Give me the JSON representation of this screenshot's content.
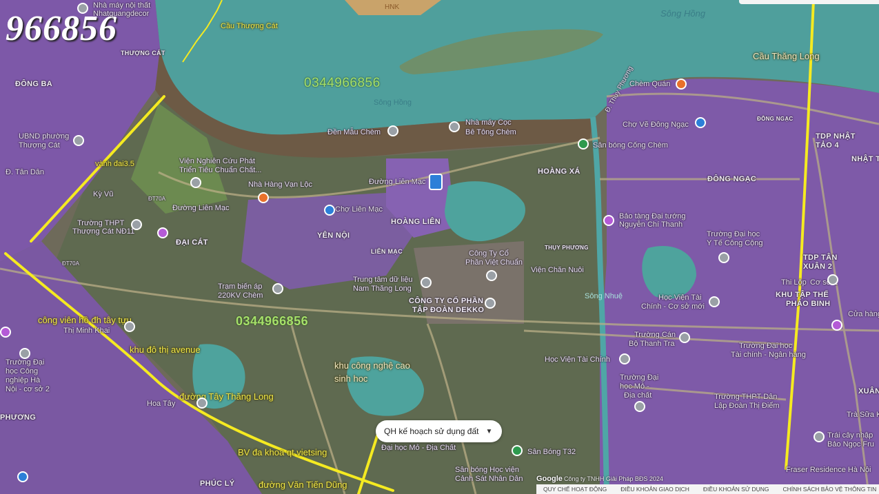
{
  "watermark": "966856",
  "phones": {
    "top": "0344966856",
    "middle": "0344966856"
  },
  "annotations": {
    "cau_thuong_cat": "Cầu Thượng Cát",
    "cau_thang_long": "Cầu Thăng Long",
    "vanh_dai": "vành đai3.5",
    "cong_vien": "công viên hồ đh tây tựu",
    "khu_do_thi": "khu đô thị avenue",
    "khu_cong_nghe": "khu công nghệ cao sinh hoc",
    "duong_tay_thang_long": "đường Tây Thăng Long",
    "bv": "BV đa khoa qt vietsing",
    "duong_van_tien_dung": "đường Văn Tiến Dũng"
  },
  "labels": {
    "nha_may_noi_that": "Nhà máy nội thất",
    "nhat_quang_decor": "Nhatquangdecor",
    "thuong_cat": "THƯỢNG CÁT",
    "dong_ba": "ĐÔNG BA",
    "ubnd": "UBND phường",
    "ubnd_2": "Thượng Cát",
    "tan_dan": "Đ. Tân Dân",
    "ky_vu": "Kỳ Vũ",
    "vien_nghien_cuu": "Viện Nghiên Cứu Phát",
    "vien_nghien_cuu_2": "Triển Tiêu Chuẩn Chất...",
    "nha_hang": "Nhà Hàng Vạn Lộc",
    "duong_lien_mac_1": "Đường Liên Mạc",
    "duong_lien_mac_2": "Đường Liên Mạc",
    "cho_lien_mac": "Chợ Liên Mạc",
    "truong_thpt": "Trường THPT",
    "truong_thpt_2": "Thượng Cát NĐ11",
    "dai_cat": "ĐẠI CÁT",
    "yen_noi": "YÊN NỘI",
    "lien_mac": "LIÊN MẠC",
    "hoang_lien": "HOÀNG LIÊN",
    "den_mau_chem": "Đền Mẫu Chèm",
    "nha_may_coc": "Nhà máy Cọc",
    "be_tong_chem": "Bê Tông Chèm",
    "song_hong_1": "Sông Hồng",
    "song_hong_2": "Sông Hồng",
    "hnk": "HNK",
    "chem_quan": "Chèm Quán",
    "thuy_phuong_road": "Đ. Thụy Phương",
    "cho_ve": "Chợ Vẽ Đông Ngạc",
    "san_bong_cong_chem": "Sân bóng Cống Chèm",
    "hoang_xa": "HOÀNG XÁ",
    "dong_ngac": "ĐÔNG NGẠC",
    "dong_ngac_2": "ĐÔNG NGẠC",
    "tdp_nhat": "TDP NHẬT",
    "tao_4": "TẢO 4",
    "nhat_ta": "NHẬT TẢ",
    "bao_tang": "Bảo tàng Đại tướng",
    "bao_tang_2": "Nguyễn Chí Thanh",
    "truong_dh_y": "Trường Đại học",
    "truong_dh_y_2": "Y Tế Công Cộng",
    "cong_ty_co": "Công Ty Cổ",
    "cong_ty_co_2": "Phần Việt Chuẩn",
    "thuy_phuong": "THỤY PHƯƠNG",
    "vien_chan_nuoi": "Viện Chăn Nuôi",
    "tram_bien_ap": "Trạm biến áp",
    "tram_bien_ap_2": "220KV Chèm",
    "trung_tam": "Trung tâm dữ liệu",
    "trung_tam_2": "Nam Thăng Long",
    "dekko": "CÔNG TY CỔ PHẦN",
    "dekko_2": "TẬP ĐOÀN DEKKO",
    "song_nhue": "Sông Nhuệ",
    "hoc_vien_tai_chinh_cs": "Học Viện Tài",
    "hoc_vien_tai_chinh_cs_2": "Chính - Cơ sở mới",
    "truong_can_bo": "Trường Cán",
    "truong_can_bo_2": "Bộ Thanh Tra",
    "hoc_vien_tai_chinh": "Học Viện Tài Chính",
    "truong_dh_mo": "Trường Đại",
    "truong_dh_mo_2": "học Mỏ -",
    "truong_dh_mo_3": "Địa chất",
    "tdp_tan": "TDP TÂN",
    "xuan_2": "XUÂN 2",
    "thi_lop": "Thi Lộp",
    "co_so_2": "Cơ sở 2",
    "khu_tap_the": "KHU TẬP THỂ",
    "phao_binh": "PHÁO BINH",
    "cua_hang": "Cửa hàng",
    "truong_dh_tai_chinh": "Trường Đại học",
    "truong_dh_tai_chinh_2": "Tài chính - Ngân hàng",
    "truong_thpt_dan_lap": "Trường THPT Dân",
    "truong_thpt_dan_lap_2": "Lập Đoàn Thị Điểm",
    "thi_minh_khai": "Thị Minh Khai",
    "hoa_tay": "Hoa Tây",
    "truong_dh_cong": "Trường Đại",
    "truong_dh_cong_2": "học Công",
    "truong_dh_cong_3": "nghiệp Hà",
    "truong_dh_cong_4": "Nội - cơ sở 2",
    "dai_hoc_mo": "Đại học Mỏ - Địa Chất",
    "san_bong_t32": "Sân Bóng T32",
    "san_bong_hv": "Sân bóng Học viện",
    "san_bong_hv_2": "Cảnh Sát Nhân Dân",
    "phuc_ly": "PHÚC LÝ",
    "fraser": "Fraser Residence Hà Nội",
    "tra_sua": "Trà Sữa K",
    "trai_cay": "Trái cây nhập",
    "trai_cay_2": "Bảo Ngọc Fru",
    "phuong_left": "PHƯƠNG",
    "xuan_right": "XUÂN",
    "road_dt70a_1": "ĐT70A",
    "road_dt70a_2": "ĐT70A"
  },
  "layer_selector": {
    "label": "QH kế hoạch sử dụng đất"
  },
  "google": "Google",
  "attribution": "Công ty TNHH Giải Pháp BĐS 2024",
  "footer": [
    "QUY CHẾ HOẠT ĐỘNG",
    "ĐIỀU KHOẢN GIAO DỊCH",
    "ĐIỀU KHOẢN SỬ DỤNG",
    "CHÍNH SÁCH BẢO VỆ THÔNG TIN"
  ],
  "colors": {
    "water": "#5aa8a6",
    "residential": "#8a5fb3",
    "agri": "#6b7a55",
    "industrial": "#7a6f6a",
    "road_yellow": "#f5ea21"
  }
}
